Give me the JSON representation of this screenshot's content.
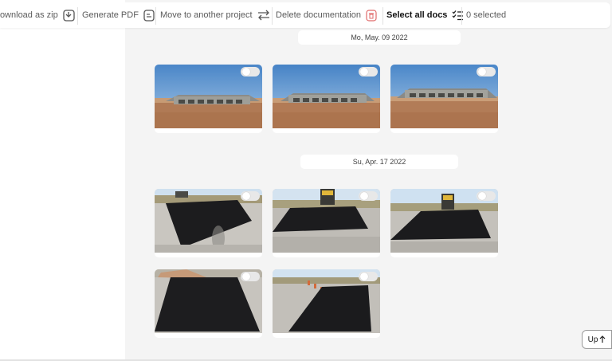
{
  "toolbar": {
    "download_label": "Download as zip",
    "pdf_label": "Generate PDF",
    "move_label": "Move to another project",
    "delete_label": "Delete documentation",
    "select_all_label": "Select all docs",
    "selected_count": "0 selected"
  },
  "groups": [
    {
      "date": "Mo, May. 09 2022",
      "photo_count": 3,
      "subject": "culvert structure under construction"
    },
    {
      "date": "Su, Apr. 17 2022",
      "photo_count": 5,
      "subject": "fresh asphalt patch on road"
    }
  ],
  "up_button": "Up",
  "colors": {
    "main_bg": "#f4f4f4",
    "delete_icon": "#e06b6b",
    "accent_top": "#f3d3c8"
  }
}
